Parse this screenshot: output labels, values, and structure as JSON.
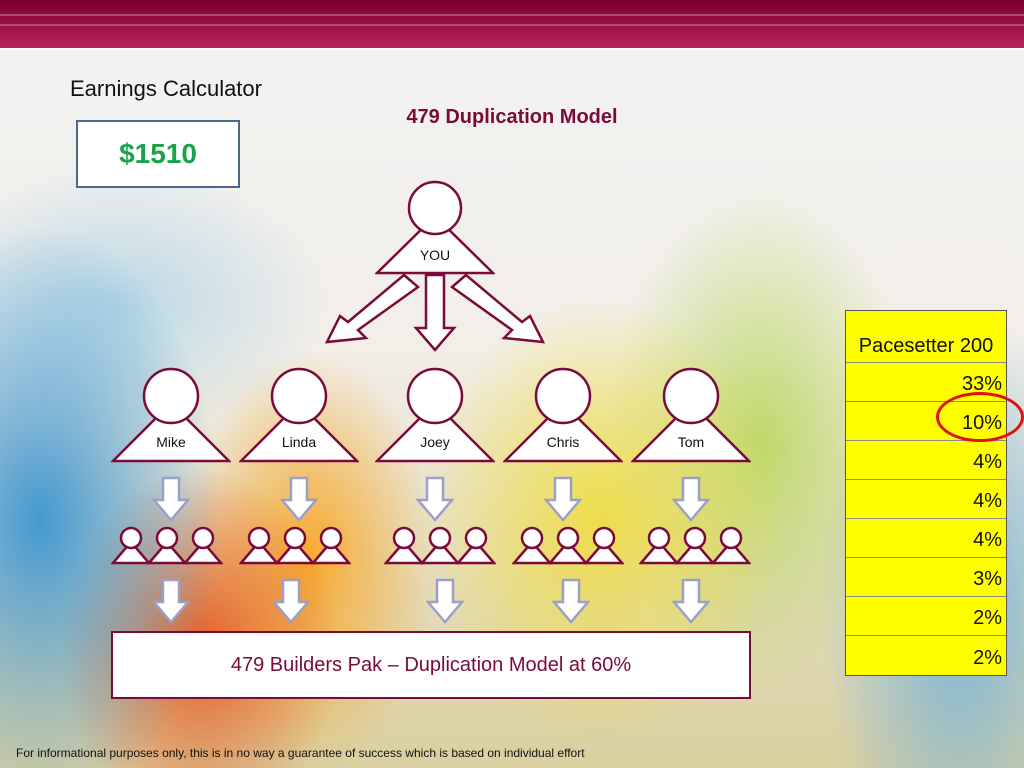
{
  "slide": {
    "calculator_title": "Earnings Calculator",
    "earnings_amount": "$1510",
    "model_title": "479 Duplication Model",
    "top_person": "YOU",
    "people": [
      "Mike",
      "Linda",
      "Joey",
      "Chris",
      "Tom"
    ],
    "builders_caption": "479 Builders Pak – Duplication Model at 60%",
    "disclaimer": "For informational purposes only, this is in no way a guarantee of success which is based on individual effort"
  },
  "rank_table": {
    "header": "Pacesetter 200",
    "values": [
      "33%",
      "10%",
      "4%",
      "4%",
      "4%",
      "3%",
      "2%",
      "2%"
    ],
    "highlighted_value": "10%"
  },
  "colors": {
    "brand": "#7a0a3a",
    "amount": "#1aa44a",
    "table_fill": "#ffff00",
    "highlight": "#e01010",
    "arrow_fill": "#ffffff",
    "arrow_stroke": "#9aa0c8"
  },
  "icons": {
    "person": "person-silhouette-icon",
    "group": "three-people-icon",
    "arrow": "down-arrow-icon"
  }
}
